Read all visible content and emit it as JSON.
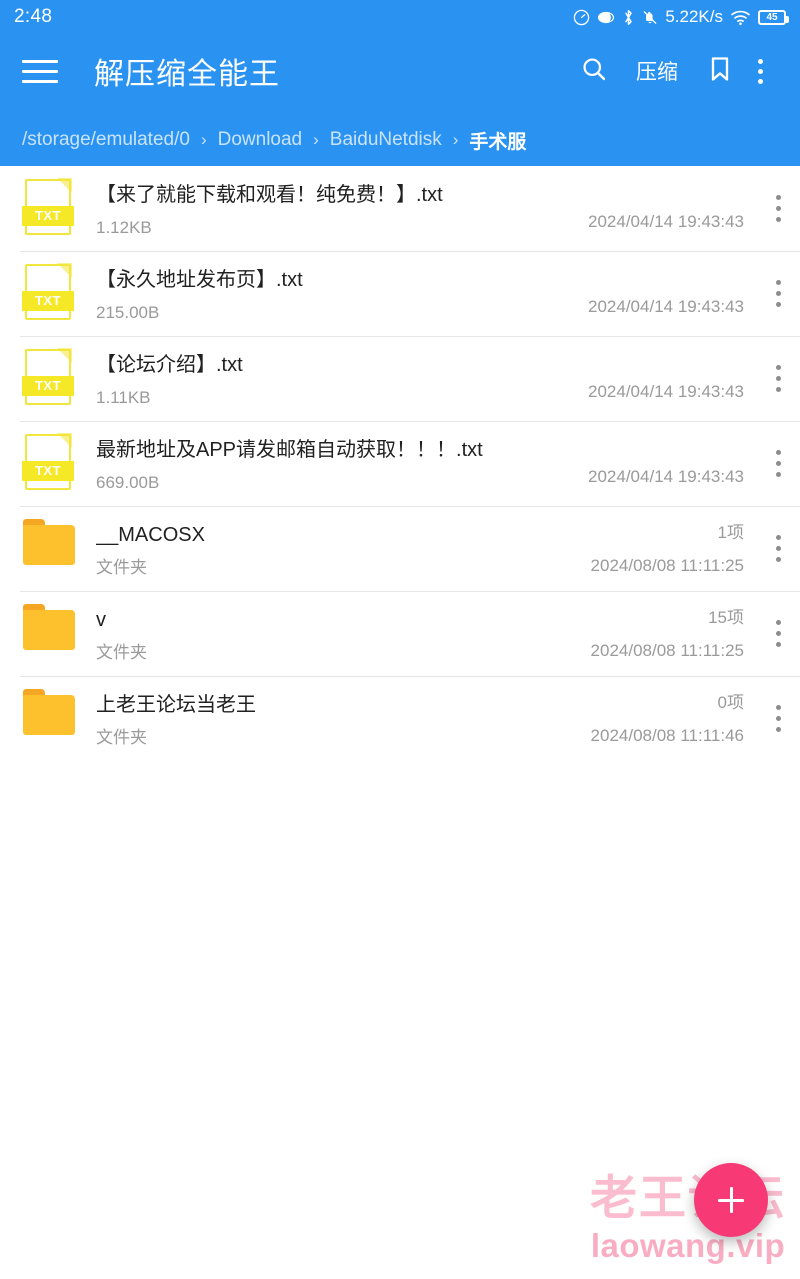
{
  "status_bar": {
    "time": "2:48",
    "network_speed": "5.22K/s",
    "battery_level": "45",
    "icons": [
      "speedometer-icon",
      "eye-care-icon",
      "bluetooth-icon",
      "mute-bell-icon",
      "wifi-icon",
      "battery-icon"
    ]
  },
  "app_bar": {
    "title": "解压缩全能王",
    "menu_icon": "hamburger-icon",
    "actions": [
      {
        "name": "search",
        "icon": "search-icon",
        "label": ""
      },
      {
        "name": "compress",
        "icon": "",
        "label": "压缩"
      },
      {
        "name": "bookmark",
        "icon": "bookmark-icon",
        "label": ""
      },
      {
        "name": "overflow",
        "icon": "kebab-menu-icon",
        "label": ""
      }
    ],
    "accent_color": "#2a93f2"
  },
  "breadcrumb": {
    "separator": "›",
    "segments": [
      {
        "label": "/storage/emulated/0",
        "current": false
      },
      {
        "label": "Download",
        "current": false
      },
      {
        "label": "BaiduNetdisk",
        "current": false
      },
      {
        "label": "手术服",
        "current": true
      }
    ]
  },
  "file_list": [
    {
      "type": "file",
      "icon": "txt-file-icon",
      "icon_label": "TXT",
      "name": "【来了就能下载和观看！纯免费！】.txt",
      "size": "1.12KB",
      "count": "",
      "date": "2024/04/14 19:43:43"
    },
    {
      "type": "file",
      "icon": "txt-file-icon",
      "icon_label": "TXT",
      "name": "【永久地址发布页】.txt",
      "size": "215.00B",
      "count": "",
      "date": "2024/04/14 19:43:43"
    },
    {
      "type": "file",
      "icon": "txt-file-icon",
      "icon_label": "TXT",
      "name": "【论坛介绍】.txt",
      "size": "1.11KB",
      "count": "",
      "date": "2024/04/14 19:43:43"
    },
    {
      "type": "file",
      "icon": "txt-file-icon",
      "icon_label": "TXT",
      "name": "最新地址及APP请发邮箱自动获取！！！.txt",
      "size": "669.00B",
      "count": "",
      "date": "2024/04/14 19:43:43"
    },
    {
      "type": "folder",
      "icon": "folder-icon",
      "icon_label": "",
      "name": "__MACOSX",
      "size": "文件夹",
      "count": "1项",
      "date": "2024/08/08 11:11:25"
    },
    {
      "type": "folder",
      "icon": "folder-icon",
      "icon_label": "",
      "name": "v",
      "size": "文件夹",
      "count": "15项",
      "date": "2024/08/08 11:11:25"
    },
    {
      "type": "folder",
      "icon": "folder-icon",
      "icon_label": "",
      "name": "上老王论坛当老王",
      "size": "文件夹",
      "count": "0项",
      "date": "2024/08/08 11:11:46"
    }
  ],
  "row_menu_icon": "kebab-menu-icon",
  "fab": {
    "icon": "plus-icon",
    "color": "#f73a76"
  },
  "watermark": {
    "line1": "老王论坛",
    "line2": "laowang.vip",
    "color": "#f03c6e"
  }
}
